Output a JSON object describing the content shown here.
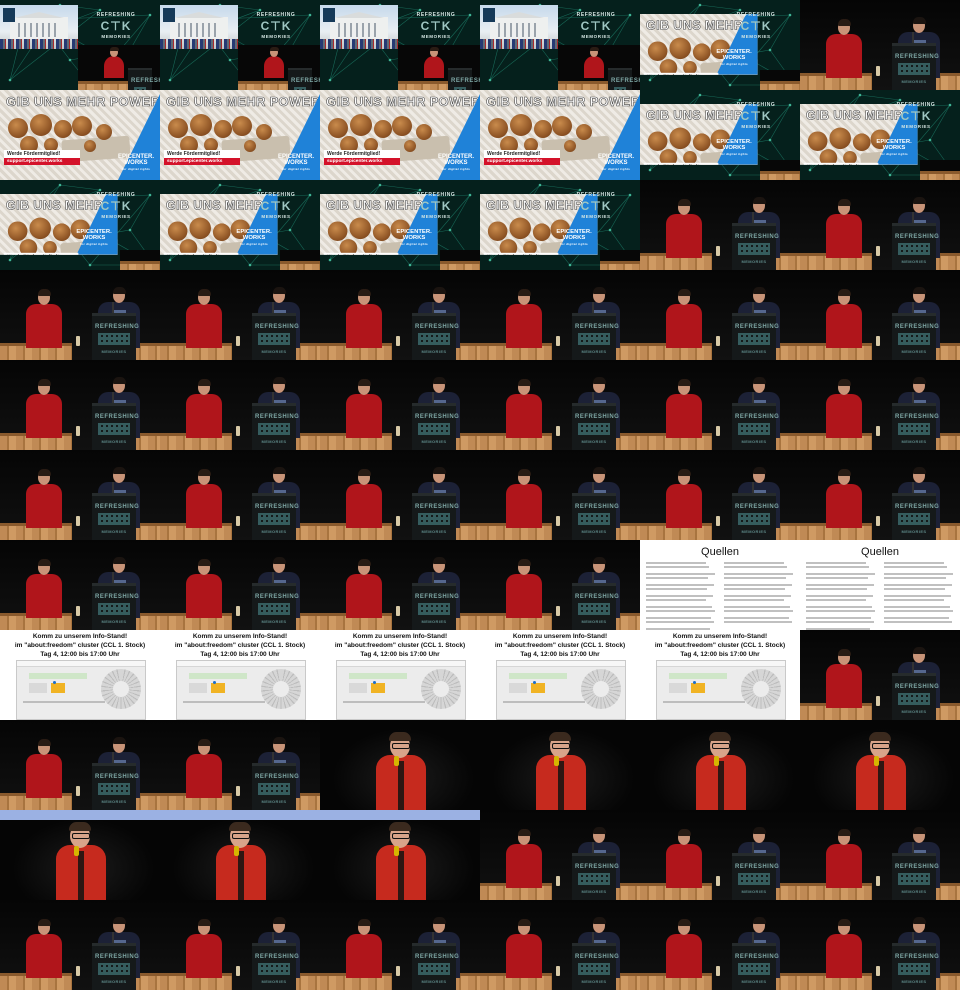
{
  "overlay_texts": {
    "refreshing": "REFRESHING",
    "memories": "MEMORIES",
    "ctk": "C⊤K"
  },
  "ad": {
    "headline": "GIB UNS MEHR POWER!",
    "cta_line1": "Werde Fördermitglied!",
    "cta_line2": "support.epicenter.works",
    "brand": "EPICENTER.",
    "brand2": "WORKS",
    "brand_sub": "for digital rights"
  },
  "quellen": {
    "title": "Quellen"
  },
  "info": {
    "line1": "Komm zu unserem Info-Stand!",
    "line2": "im \"about:freedom\" cluster (CCL 1. Stock)",
    "line3": "Tag 4, 12:00 bis 17:00 Uhr"
  },
  "colors": {
    "stand_highlight": "#f0b323",
    "ad_red": "#d4122a",
    "ad_blue": "#1f82d8",
    "shirt_red": "#b0151b",
    "jacket_red": "#c62a1e"
  }
}
